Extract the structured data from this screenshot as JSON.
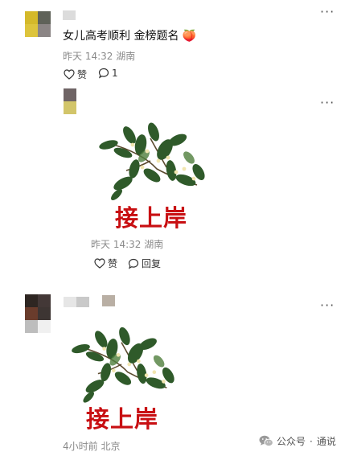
{
  "comments": [
    {
      "text": "女儿高考顺利 金榜题名",
      "emoji": "🍑",
      "time": "昨天 14:32",
      "location": "湖南",
      "like_label": "赞",
      "reply_count": "1"
    },
    {
      "time": "昨天 14:32",
      "location": "湖南",
      "like_label": "赞",
      "reply_label": "回复",
      "sticker_text": "接上岸"
    },
    {
      "time": "4小时前",
      "location": "北京",
      "sticker_text": "接上岸"
    }
  ],
  "watermark": {
    "name": "公众号",
    "dot": "·",
    "account": "通说"
  },
  "icons": {
    "more": "more-dots-icon",
    "like": "heart-outline-icon",
    "comment": "speech-bubble-icon",
    "watermark": "wechat-icon"
  },
  "colors": {
    "sticker_red": "#c80f12",
    "leaf_green": "#2f5a2a"
  }
}
